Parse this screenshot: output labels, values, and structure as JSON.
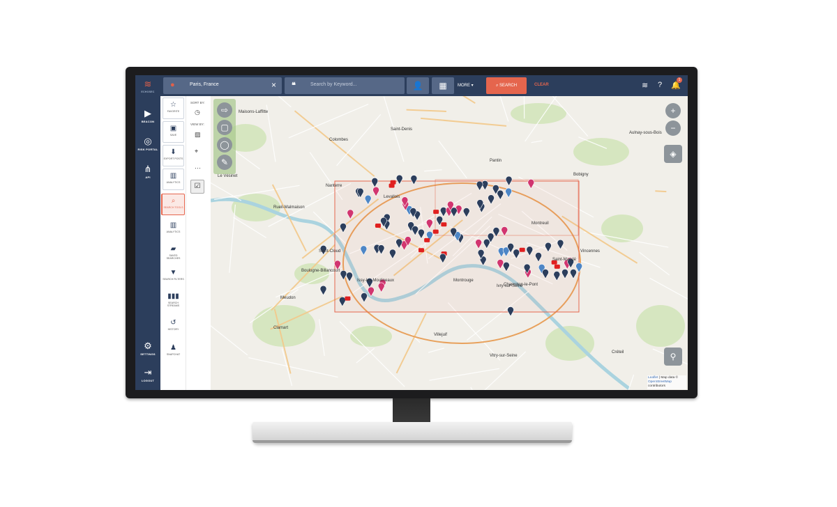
{
  "rail": {
    "logo_label": "ECHOSEC",
    "items": [
      {
        "label": "BEACON",
        "icon": "beacon-icon"
      },
      {
        "label": "RISK PORTAL",
        "icon": "fingerprint-icon"
      },
      {
        "label": "API",
        "icon": "api-icon"
      }
    ],
    "bottom": [
      {
        "label": "SETTINGS",
        "icon": "gear-icon"
      },
      {
        "label": "LOGOUT",
        "icon": "logout-icon"
      }
    ]
  },
  "topbar": {
    "location_value": "Paris, France",
    "keyword_placeholder": "Search by Keyword...",
    "more_label": "MORE",
    "search_label": "SEARCH",
    "clear_label": "CLEAR",
    "notification_count": "1"
  },
  "tools": [
    {
      "label": "FAVORITE",
      "icon": "star-icon"
    },
    {
      "label": "SAVE",
      "icon": "save-icon"
    },
    {
      "label": "EXPORT POSTS",
      "icon": "download-icon"
    },
    {
      "label": "ANALYTICS",
      "icon": "analytics-icon"
    },
    {
      "label": "SEARCH TOOLS",
      "icon": "search-icon"
    },
    {
      "label": "ANALYTICS",
      "icon": "analytics-icon"
    },
    {
      "label": "SAVED SEARCHES",
      "icon": "folder-icon"
    },
    {
      "label": "SEARCH FILTERS",
      "icon": "filter-icon"
    },
    {
      "label": "SEARCH STREAMS",
      "icon": "streams-icon"
    },
    {
      "label": "HISTORY",
      "icon": "history-icon"
    },
    {
      "label": "SNAPCHAT",
      "icon": "snapchat-icon"
    }
  ],
  "sort": {
    "sort_by": "SORT BY:",
    "view_by": "VIEW BY:"
  },
  "map": {
    "places": [
      {
        "name": "Saint-Denis"
      },
      {
        "name": "Levallois"
      },
      {
        "name": "Montreuil"
      },
      {
        "name": "Saint-Cloud"
      },
      {
        "name": "Boulogne-Billancourt"
      },
      {
        "name": "Saint-Mandé"
      },
      {
        "name": "Issy-les-Moulineaux"
      },
      {
        "name": "Montrouge"
      },
      {
        "name": "Ivry-sur-Seine"
      },
      {
        "name": "Charenton-le-Pont"
      },
      {
        "name": "Maisons-Laffitte"
      },
      {
        "name": "Nanterre"
      },
      {
        "name": "Colombes"
      },
      {
        "name": "Rueil-Malmaison"
      },
      {
        "name": "Pantin"
      },
      {
        "name": "Bobigny"
      },
      {
        "name": "Vincennes"
      },
      {
        "name": "Clamart"
      },
      {
        "name": "Meudon"
      },
      {
        "name": "Vitry-sur-Seine"
      },
      {
        "name": "Villejuif"
      },
      {
        "name": "Créteil"
      },
      {
        "name": "Aulnay-sous-Bois"
      },
      {
        "name": "Le Vésinet"
      }
    ],
    "attribution_leaflet": "Leaflet",
    "attribution_text": "| Map data ©",
    "attribution_osm": "OpenStreetMap",
    "attribution_contrib": "contributors"
  },
  "colors": {
    "nav": "#2c3e5c",
    "accent": "#e5654d",
    "pin_dark": "#2c3e5c",
    "pin_pink": "#d1356f",
    "pin_blue": "#4d86c6",
    "pin_red": "#e02020"
  }
}
